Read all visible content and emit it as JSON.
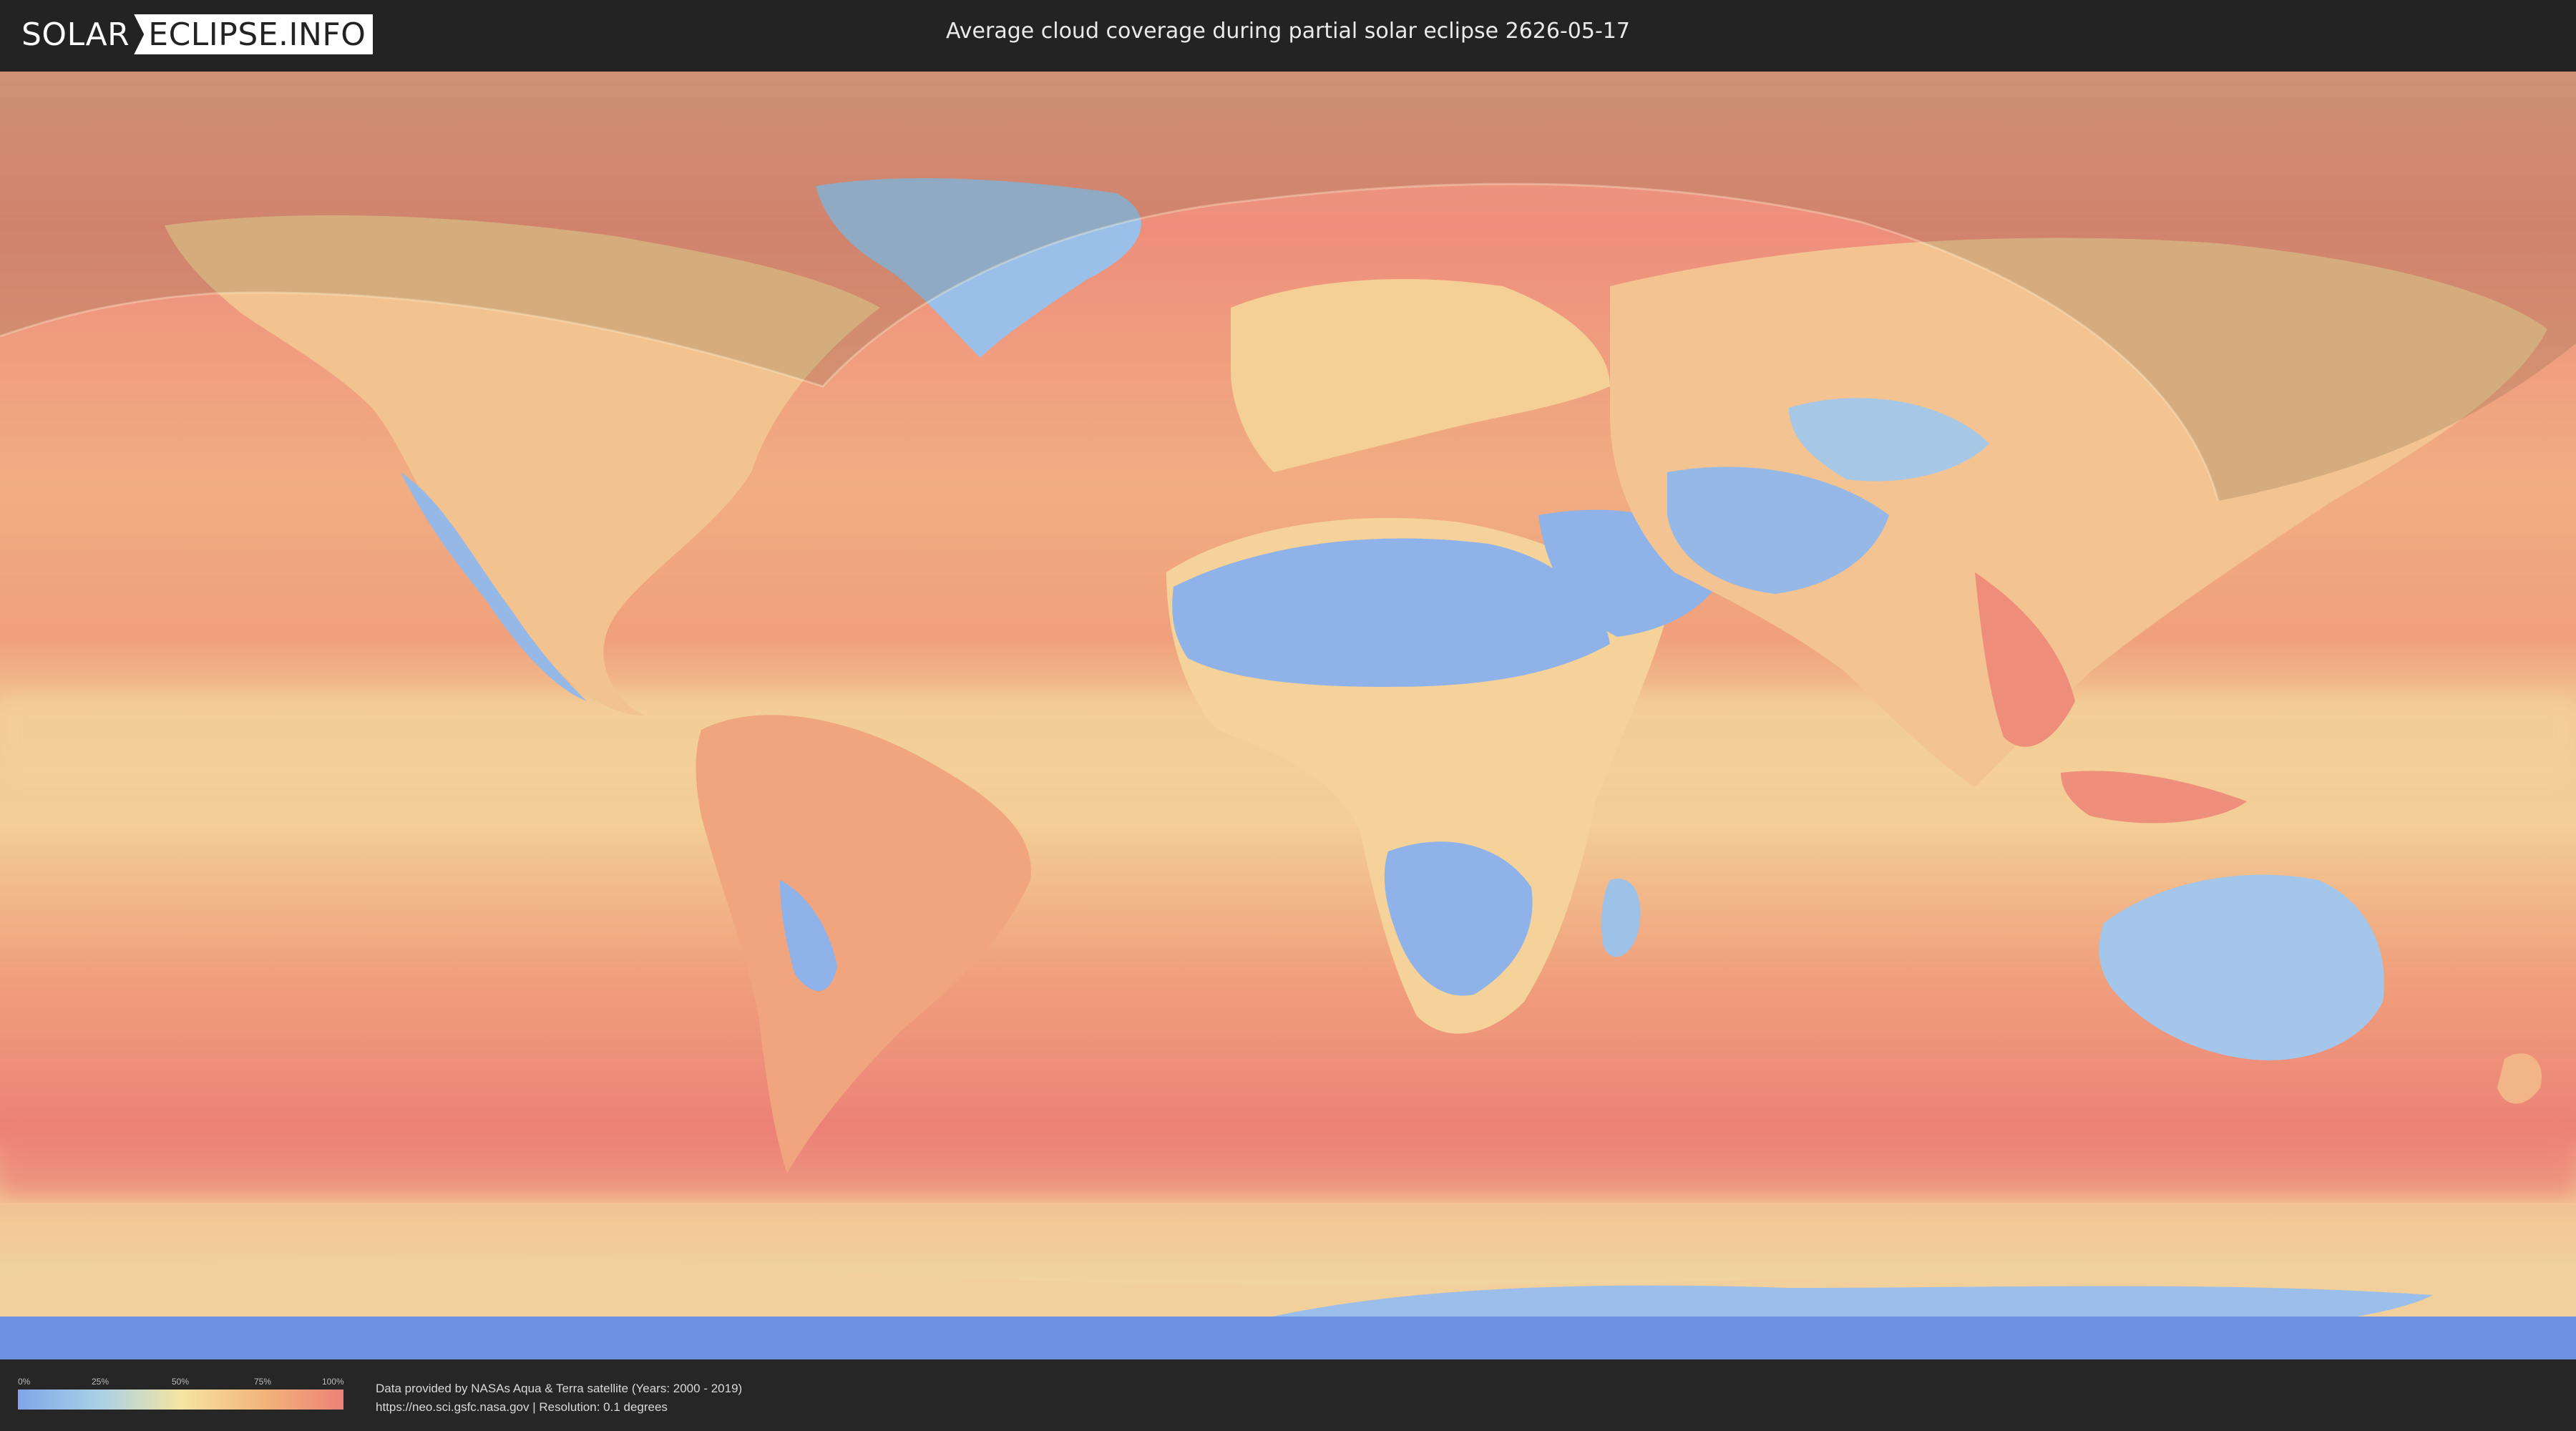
{
  "header": {
    "logo_left": "SOLAR",
    "logo_right": "ECLIPSE.INFO",
    "title": "Average cloud coverage during partial solar eclipse 2626-05-17"
  },
  "map": {
    "ocean_cloud_color": "#ee8a7a",
    "clear_land_color": "#8fb3e8",
    "mid_color": "#f5d99a",
    "eclipse_shading_color": "#8a7a5a"
  },
  "legend": {
    "ticks": [
      "0%",
      "25%",
      "50%",
      "75%",
      "100%"
    ],
    "colors": [
      "#7fa6e8",
      "#a9d0e6",
      "#f4e4a2",
      "#f3b57a",
      "#ee8278"
    ]
  },
  "credits": {
    "line1": "Data provided by NASAs Aqua & Terra satellite (Years: 2000 - 2019)",
    "line2": "https://neo.sci.gsfc.nasa.gov | Resolution: 0.1 degrees"
  }
}
